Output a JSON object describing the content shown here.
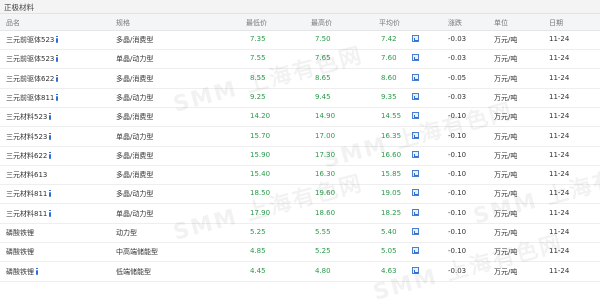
{
  "section": {
    "title": "正极材料"
  },
  "columns": {
    "name": "品名",
    "spec": "规格",
    "low": "最低价",
    "high": "最高价",
    "avg": "平均价",
    "change": "涨跌",
    "unit": "单位",
    "date": "日期"
  },
  "rows": [
    {
      "name": "三元前驱体523",
      "info": true,
      "spec": "多晶/消费型",
      "low": "7.35",
      "high": "7.50",
      "avg": "7.42",
      "change": "-0.03",
      "unit": "万元/吨",
      "date": "11-24"
    },
    {
      "name": "三元前驱体523",
      "info": true,
      "spec": "单晶/动力型",
      "low": "7.55",
      "high": "7.65",
      "avg": "7.60",
      "change": "-0.03",
      "unit": "万元/吨",
      "date": "11-24"
    },
    {
      "name": "三元前驱体622",
      "info": true,
      "spec": "多晶/消费型",
      "low": "8.55",
      "high": "8.65",
      "avg": "8.60",
      "change": "-0.05",
      "unit": "万元/吨",
      "date": "11-24"
    },
    {
      "name": "三元前驱体811",
      "info": true,
      "spec": "多晶/动力型",
      "low": "9.25",
      "high": "9.45",
      "avg": "9.35",
      "change": "-0.03",
      "unit": "万元/吨",
      "date": "11-24"
    },
    {
      "name": "三元材料523",
      "info": true,
      "spec": "多晶/消费型",
      "low": "14.20",
      "high": "14.90",
      "avg": "14.55",
      "change": "-0.10",
      "unit": "万元/吨",
      "date": "11-24"
    },
    {
      "name": "三元材料523",
      "info": true,
      "spec": "单晶/动力型",
      "low": "15.70",
      "high": "17.00",
      "avg": "16.35",
      "change": "-0.10",
      "unit": "万元/吨",
      "date": "11-24"
    },
    {
      "name": "三元材料622",
      "info": true,
      "spec": "多晶/消费型",
      "low": "15.90",
      "high": "17.30",
      "avg": "16.60",
      "change": "-0.10",
      "unit": "万元/吨",
      "date": "11-24"
    },
    {
      "name": "三元材料613",
      "info": false,
      "spec": "多晶/消费型",
      "low": "15.40",
      "high": "16.30",
      "avg": "15.85",
      "change": "-0.10",
      "unit": "万元/吨",
      "date": "11-24"
    },
    {
      "name": "三元材料811",
      "info": true,
      "spec": "多晶/动力型",
      "low": "18.50",
      "high": "19.60",
      "avg": "19.05",
      "change": "-0.10",
      "unit": "万元/吨",
      "date": "11-24"
    },
    {
      "name": "三元材料811",
      "info": true,
      "spec": "单晶/动力型",
      "low": "17.90",
      "high": "18.60",
      "avg": "18.25",
      "change": "-0.10",
      "unit": "万元/吨",
      "date": "11-24"
    },
    {
      "name": "磷酸铁锂",
      "info": false,
      "spec": "动力型",
      "low": "5.25",
      "high": "5.55",
      "avg": "5.40",
      "change": "-0.10",
      "unit": "万元/吨",
      "date": "11-24"
    },
    {
      "name": "磷酸铁锂",
      "info": false,
      "spec": "中高端储能型",
      "low": "4.85",
      "high": "5.25",
      "avg": "5.05",
      "change": "-0.10",
      "unit": "万元/吨",
      "date": "11-24"
    },
    {
      "name": "磷酸铁锂",
      "info": true,
      "spec": "低端储能型",
      "low": "4.45",
      "high": "4.80",
      "avg": "4.63",
      "change": "-0.03",
      "unit": "万元/吨",
      "date": "11-24"
    }
  ],
  "watermark": {
    "text": "SMM 上海有色网"
  },
  "icons": {
    "info": "info-icon",
    "chart": "chart-icon"
  },
  "colors": {
    "price_green": "#2a9a4a",
    "info_blue": "#2b6fd6"
  }
}
